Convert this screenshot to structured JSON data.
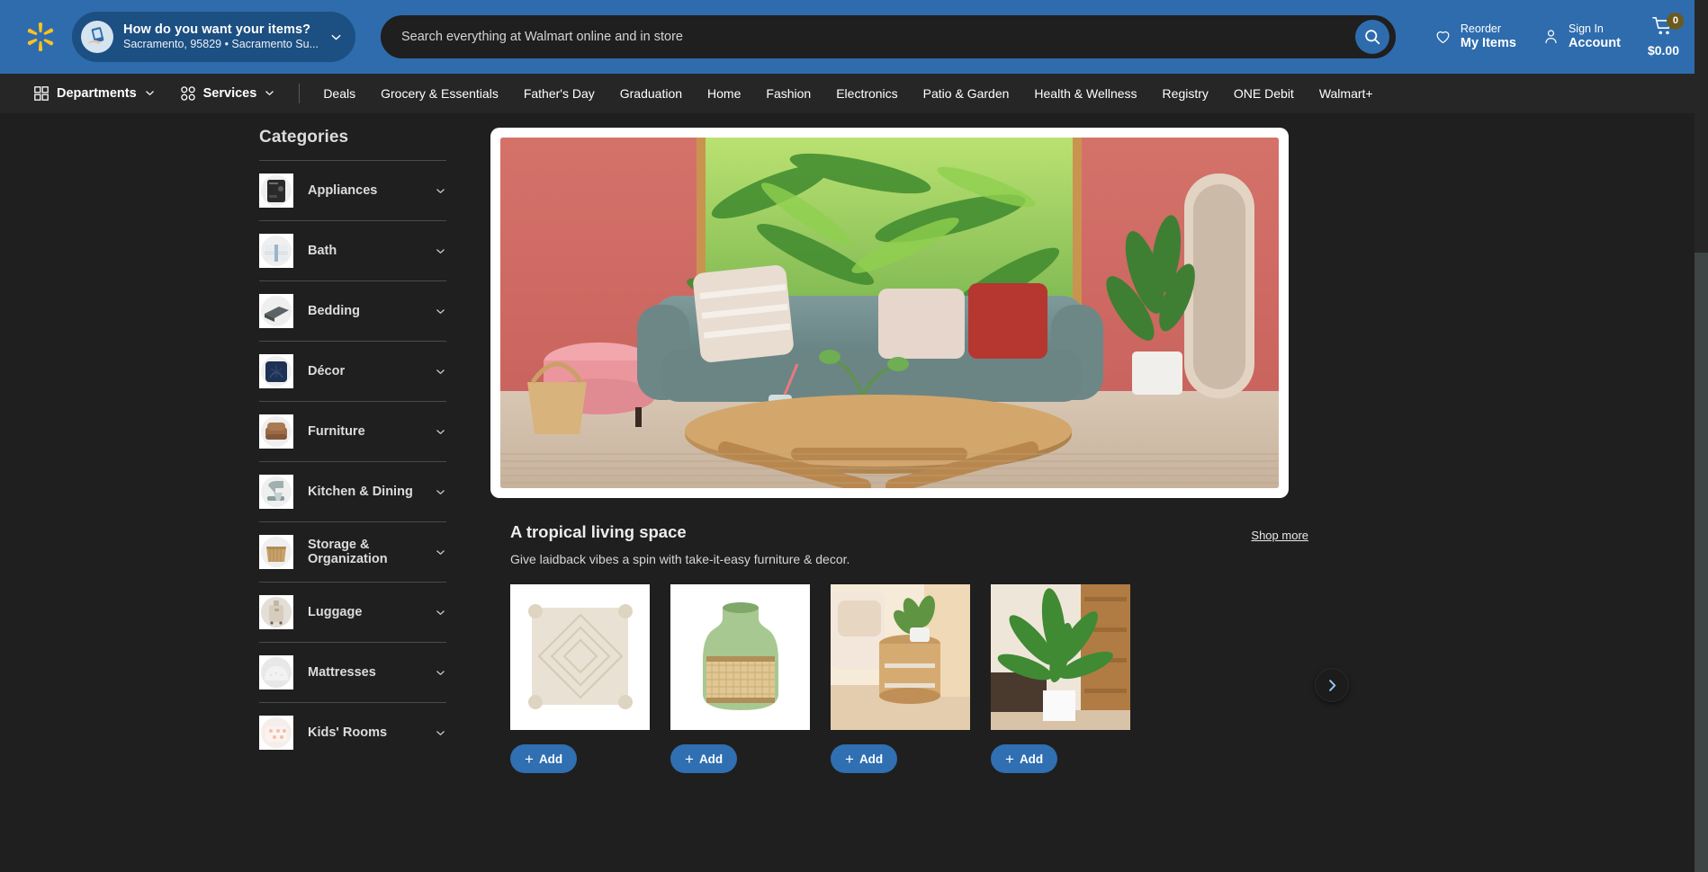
{
  "colors": {
    "header_blue": "#2e6cad",
    "fulfillment_blue": "#1c4f82",
    "nav_dark": "#262626",
    "page_dark": "#1f1f1f",
    "add_button_blue": "#2f6fb2",
    "cart_badge": "#6b5a20",
    "spark_yellow": "#ffc220"
  },
  "header": {
    "logo": "walmart-spark-icon",
    "fulfillment": {
      "title": "How do you want your items?",
      "subtitle": "Sacramento, 95829 • Sacramento Su...",
      "icon": "hand-holding-phone-icon",
      "chevron": "chevron-down-icon"
    },
    "search": {
      "placeholder": "Search everything at Walmart online and in store",
      "value": "",
      "button_icon": "search-icon"
    },
    "actions": [
      {
        "icon": "heart-icon",
        "line1": "Reorder",
        "line2": "My Items"
      },
      {
        "icon": "user-icon",
        "line1": "Sign In",
        "line2": "Account"
      }
    ],
    "cart": {
      "icon": "shopping-cart-icon",
      "count": "0",
      "total": "$0.00"
    }
  },
  "nav": {
    "departments": {
      "label": "Departments",
      "icon": "grid-squares-icon",
      "chevron": "chevron-down-icon"
    },
    "services": {
      "label": "Services",
      "icon": "grid-circles-icon",
      "chevron": "chevron-down-icon"
    },
    "links": [
      "Deals",
      "Grocery & Essentials",
      "Father's Day",
      "Graduation",
      "Home",
      "Fashion",
      "Electronics",
      "Patio & Garden",
      "Health & Wellness",
      "Registry",
      "ONE Debit",
      "Walmart+"
    ]
  },
  "sidebar": {
    "title": "Categories",
    "items": [
      {
        "label": "Appliances",
        "thumb": "air-fryer-thumb"
      },
      {
        "label": "Bath",
        "thumb": "folded-towels-thumb"
      },
      {
        "label": "Bedding",
        "thumb": "folded-blanket-thumb"
      },
      {
        "label": "Décor",
        "thumb": "navy-pillow-thumb"
      },
      {
        "label": "Furniture",
        "thumb": "brown-sofa-thumb"
      },
      {
        "label": "Kitchen & Dining",
        "thumb": "stand-mixer-thumb"
      },
      {
        "label": "Storage & Organization",
        "thumb": "wicker-bin-thumb"
      },
      {
        "label": "Luggage",
        "thumb": "suitcase-thumb"
      },
      {
        "label": "Mattresses",
        "thumb": "mattress-thumb"
      },
      {
        "label": "Kids' Rooms",
        "thumb": "kids-bedding-thumb"
      }
    ],
    "chevron": "chevron-down-icon"
  },
  "main": {
    "hero": {
      "alt": "tropical-living-room-banner",
      "description": "Teal sofa with pillows, round wood coffee table, pink wall and palm view"
    },
    "section": {
      "title": "A tropical living space",
      "subtitle": "Give laidback vibes a spin with take-it-easy furniture & decor.",
      "shop_more": "Shop more"
    },
    "products": [
      {
        "name": "textured-cream-pillow",
        "add_label": "Add"
      },
      {
        "name": "green-glass-rattan-vase",
        "add_label": "Add"
      },
      {
        "name": "rattan-side-table",
        "add_label": "Add"
      },
      {
        "name": "faux-palm-plant",
        "add_label": "Add"
      }
    ],
    "carousel_next_icon": "chevron-right-icon"
  }
}
